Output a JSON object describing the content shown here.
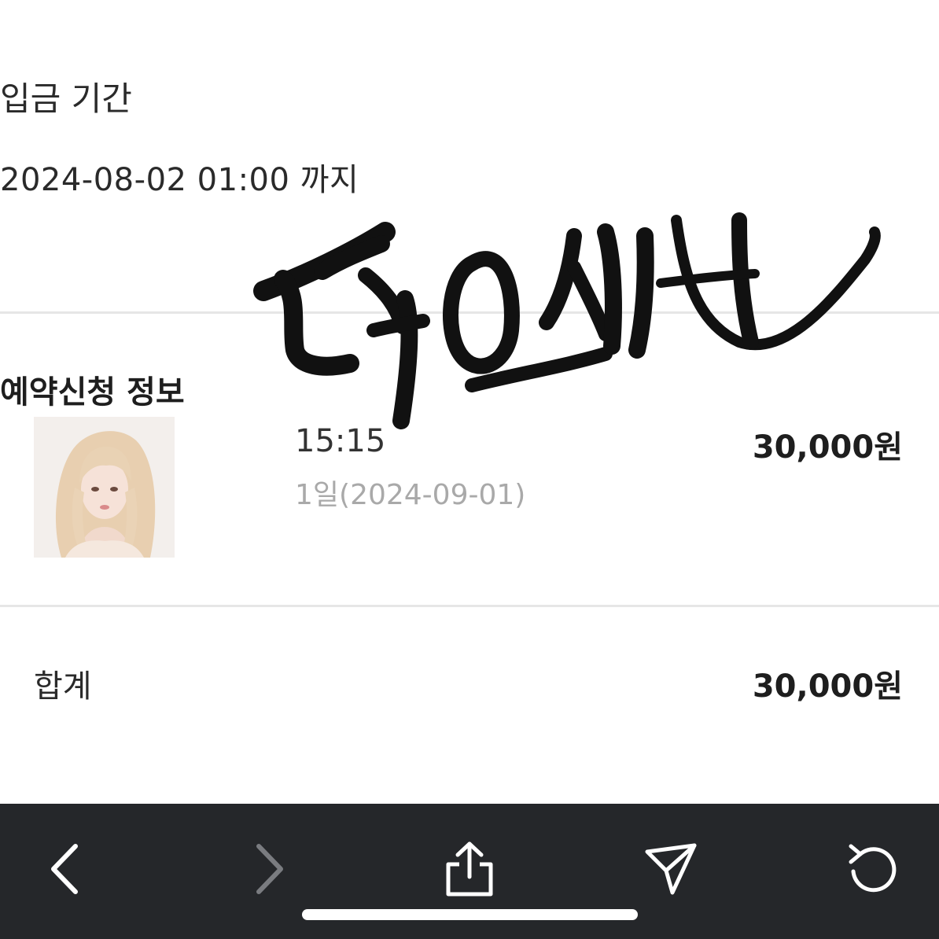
{
  "deposit": {
    "label": "입금 기간",
    "deadline": "2024-08-02 01:00 까지"
  },
  "reservation": {
    "title": "예약신청 정보",
    "item": {
      "time": "15:15",
      "date": "1일(2024-09-01)",
      "price": "30,000원"
    }
  },
  "summary": {
    "label": "합계",
    "total": "30,000원"
  },
  "signature": {
    "text": "덕오사"
  },
  "toolbar": {
    "back_icon": "chevron-left-icon",
    "forward_icon": "chevron-right-icon",
    "share_icon": "share-icon",
    "send_icon": "send-icon",
    "reload_icon": "reload-icon"
  },
  "colors": {
    "toolbar_bg": "#25272a",
    "divider": "#e6e6e6",
    "muted_text": "#a9a9a9",
    "ink": "#111111"
  }
}
